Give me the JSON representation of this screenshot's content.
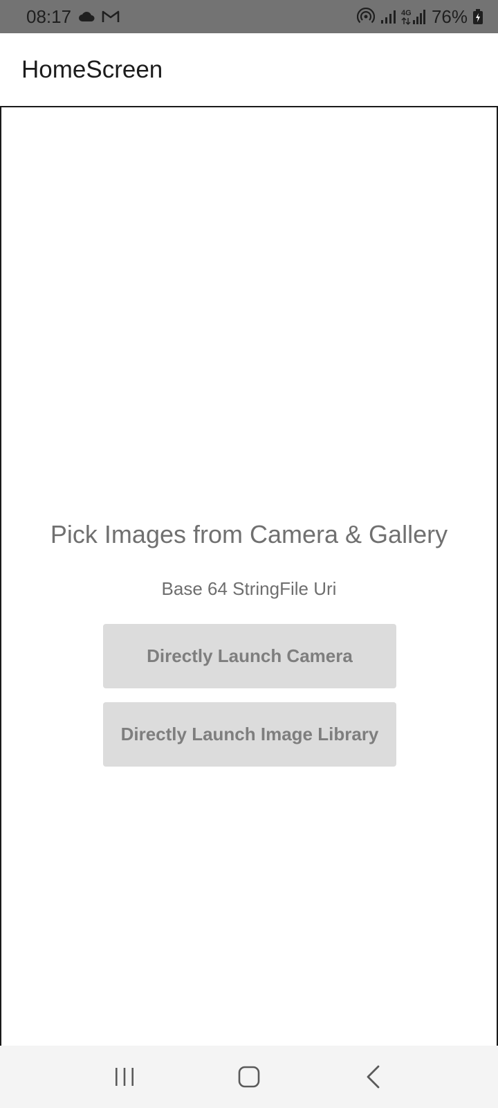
{
  "status_bar": {
    "time": "08:17",
    "battery_percent": "76%",
    "network_label": "4G",
    "icons": [
      "cloud-icon",
      "gmail-icon",
      "hotspot-icon",
      "signal-icon",
      "signal-4g-icon",
      "battery-charging-icon"
    ]
  },
  "app_bar": {
    "title": "HomeScreen"
  },
  "main": {
    "heading": "Pick Images from Camera & Gallery",
    "subheading": "Base 64 StringFile Uri",
    "buttons": [
      {
        "label": "Directly Launch Camera"
      },
      {
        "label": "Directly Launch Image Library"
      }
    ]
  },
  "nav_bar": {
    "icons": [
      "recent-apps-icon",
      "home-icon",
      "back-icon"
    ]
  },
  "colors": {
    "status_bar_bg": "#737373",
    "button_bg": "#dcdcdc",
    "button_text": "#7e7e7e",
    "heading_text": "#707070",
    "nav_bar_bg": "#f4f4f4"
  }
}
